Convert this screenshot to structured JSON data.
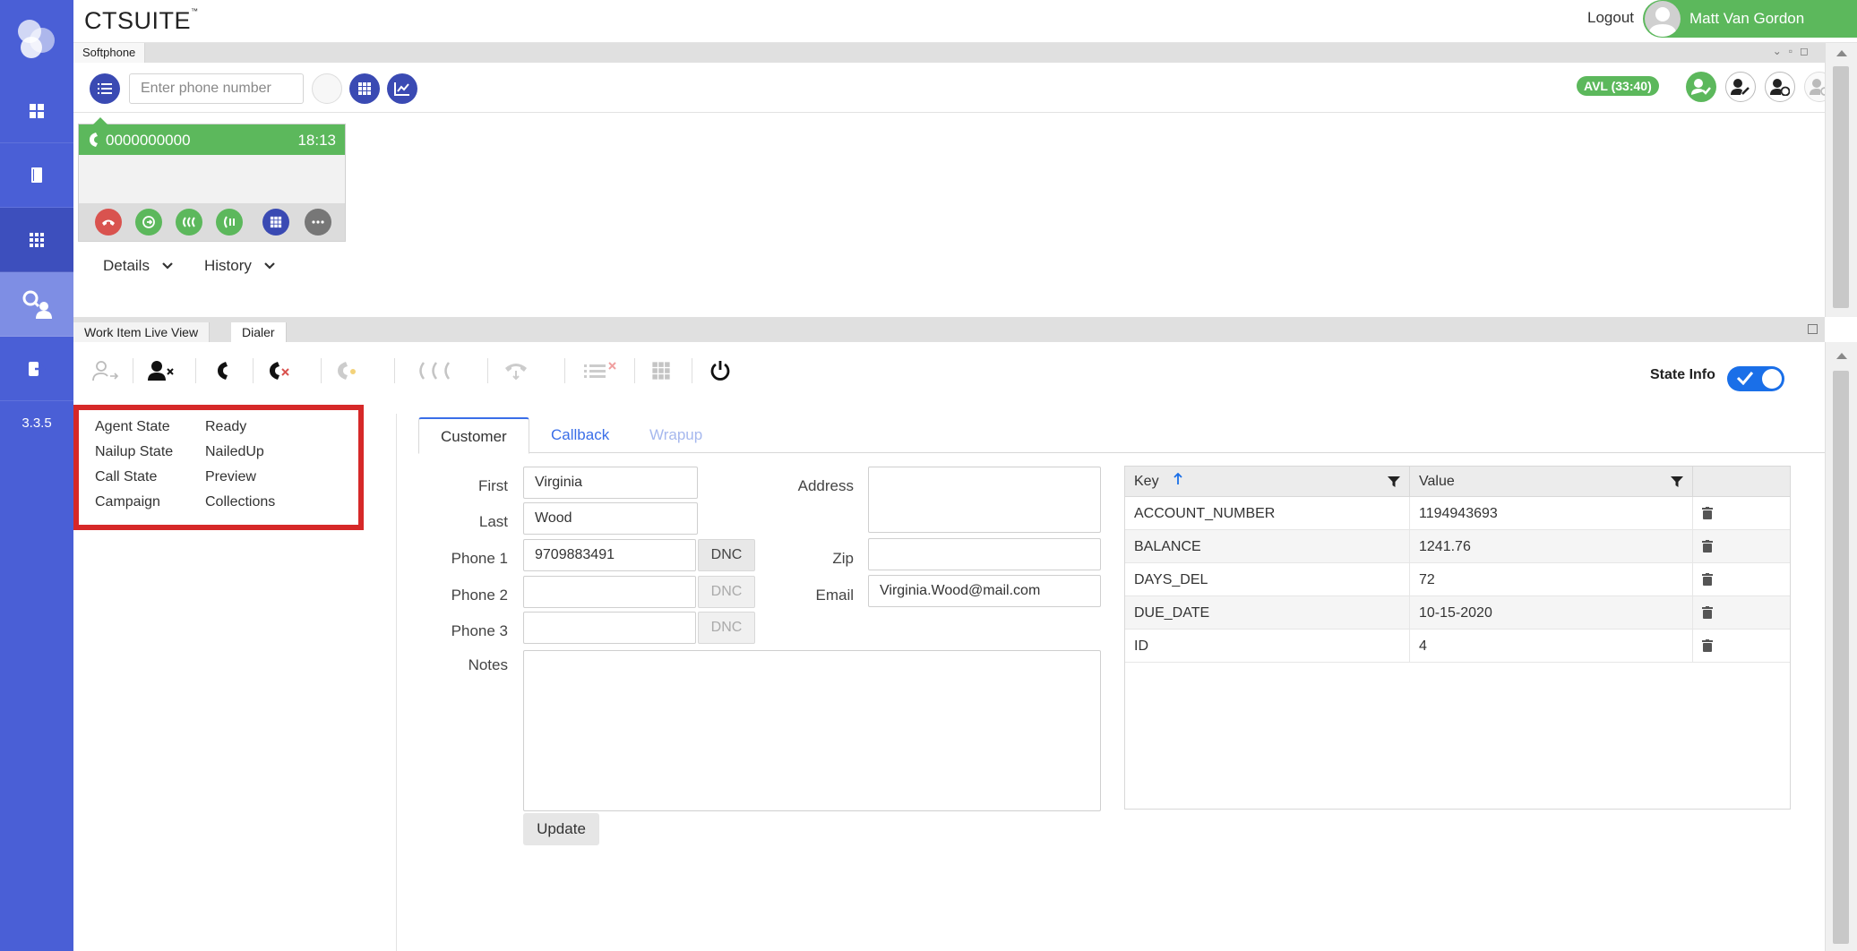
{
  "app": {
    "brand": "CTSUITE",
    "version": "3.3.5"
  },
  "header": {
    "logout_label": "Logout",
    "user_name": "Matt Van Gordon"
  },
  "softphone": {
    "tab_label": "Softphone",
    "phone_placeholder": "Enter phone number",
    "avl_badge": "AVL (33:40)",
    "call": {
      "number": "0000000000",
      "duration": "18:13"
    },
    "details_label": "Details",
    "history_label": "History"
  },
  "dialer": {
    "tabs": [
      "Work Item Live View",
      "Dialer"
    ],
    "state_info_label": "State Info",
    "agent_state": [
      {
        "label": "Agent State",
        "value": "Ready"
      },
      {
        "label": "Nailup State",
        "value": "NailedUp"
      },
      {
        "label": "Call State",
        "value": "Preview"
      },
      {
        "label": "Campaign",
        "value": "Collections"
      }
    ],
    "content_tabs": [
      "Customer",
      "Callback",
      "Wrapup"
    ],
    "form": {
      "first_label": "First",
      "first_value": "Virginia",
      "last_label": "Last",
      "last_value": "Wood",
      "phone1_label": "Phone 1",
      "phone1_value": "9709883491",
      "phone2_label": "Phone 2",
      "phone2_value": "",
      "phone3_label": "Phone 3",
      "phone3_value": "",
      "dnc_label": "DNC",
      "notes_label": "Notes",
      "address_label": "Address",
      "address_value": "",
      "zip_label": "Zip",
      "zip_value": "",
      "email_label": "Email",
      "email_value": "Virginia.Wood@mail.com",
      "update_label": "Update"
    },
    "kv_table": {
      "headers": [
        "Key",
        "Value"
      ],
      "rows": [
        {
          "key": "ACCOUNT_NUMBER",
          "value": "1194943693"
        },
        {
          "key": "BALANCE",
          "value": "1241.76"
        },
        {
          "key": "DAYS_DEL",
          "value": "72"
        },
        {
          "key": "DUE_DATE",
          "value": "10-15-2020"
        },
        {
          "key": "ID",
          "value": "4"
        }
      ]
    }
  },
  "colors": {
    "sidebar": "#4a5fd6",
    "accent": "#5cb85c",
    "primary_button": "#3a4ab3",
    "highlight_box": "#d62828",
    "toggle": "#1a6fe8"
  }
}
